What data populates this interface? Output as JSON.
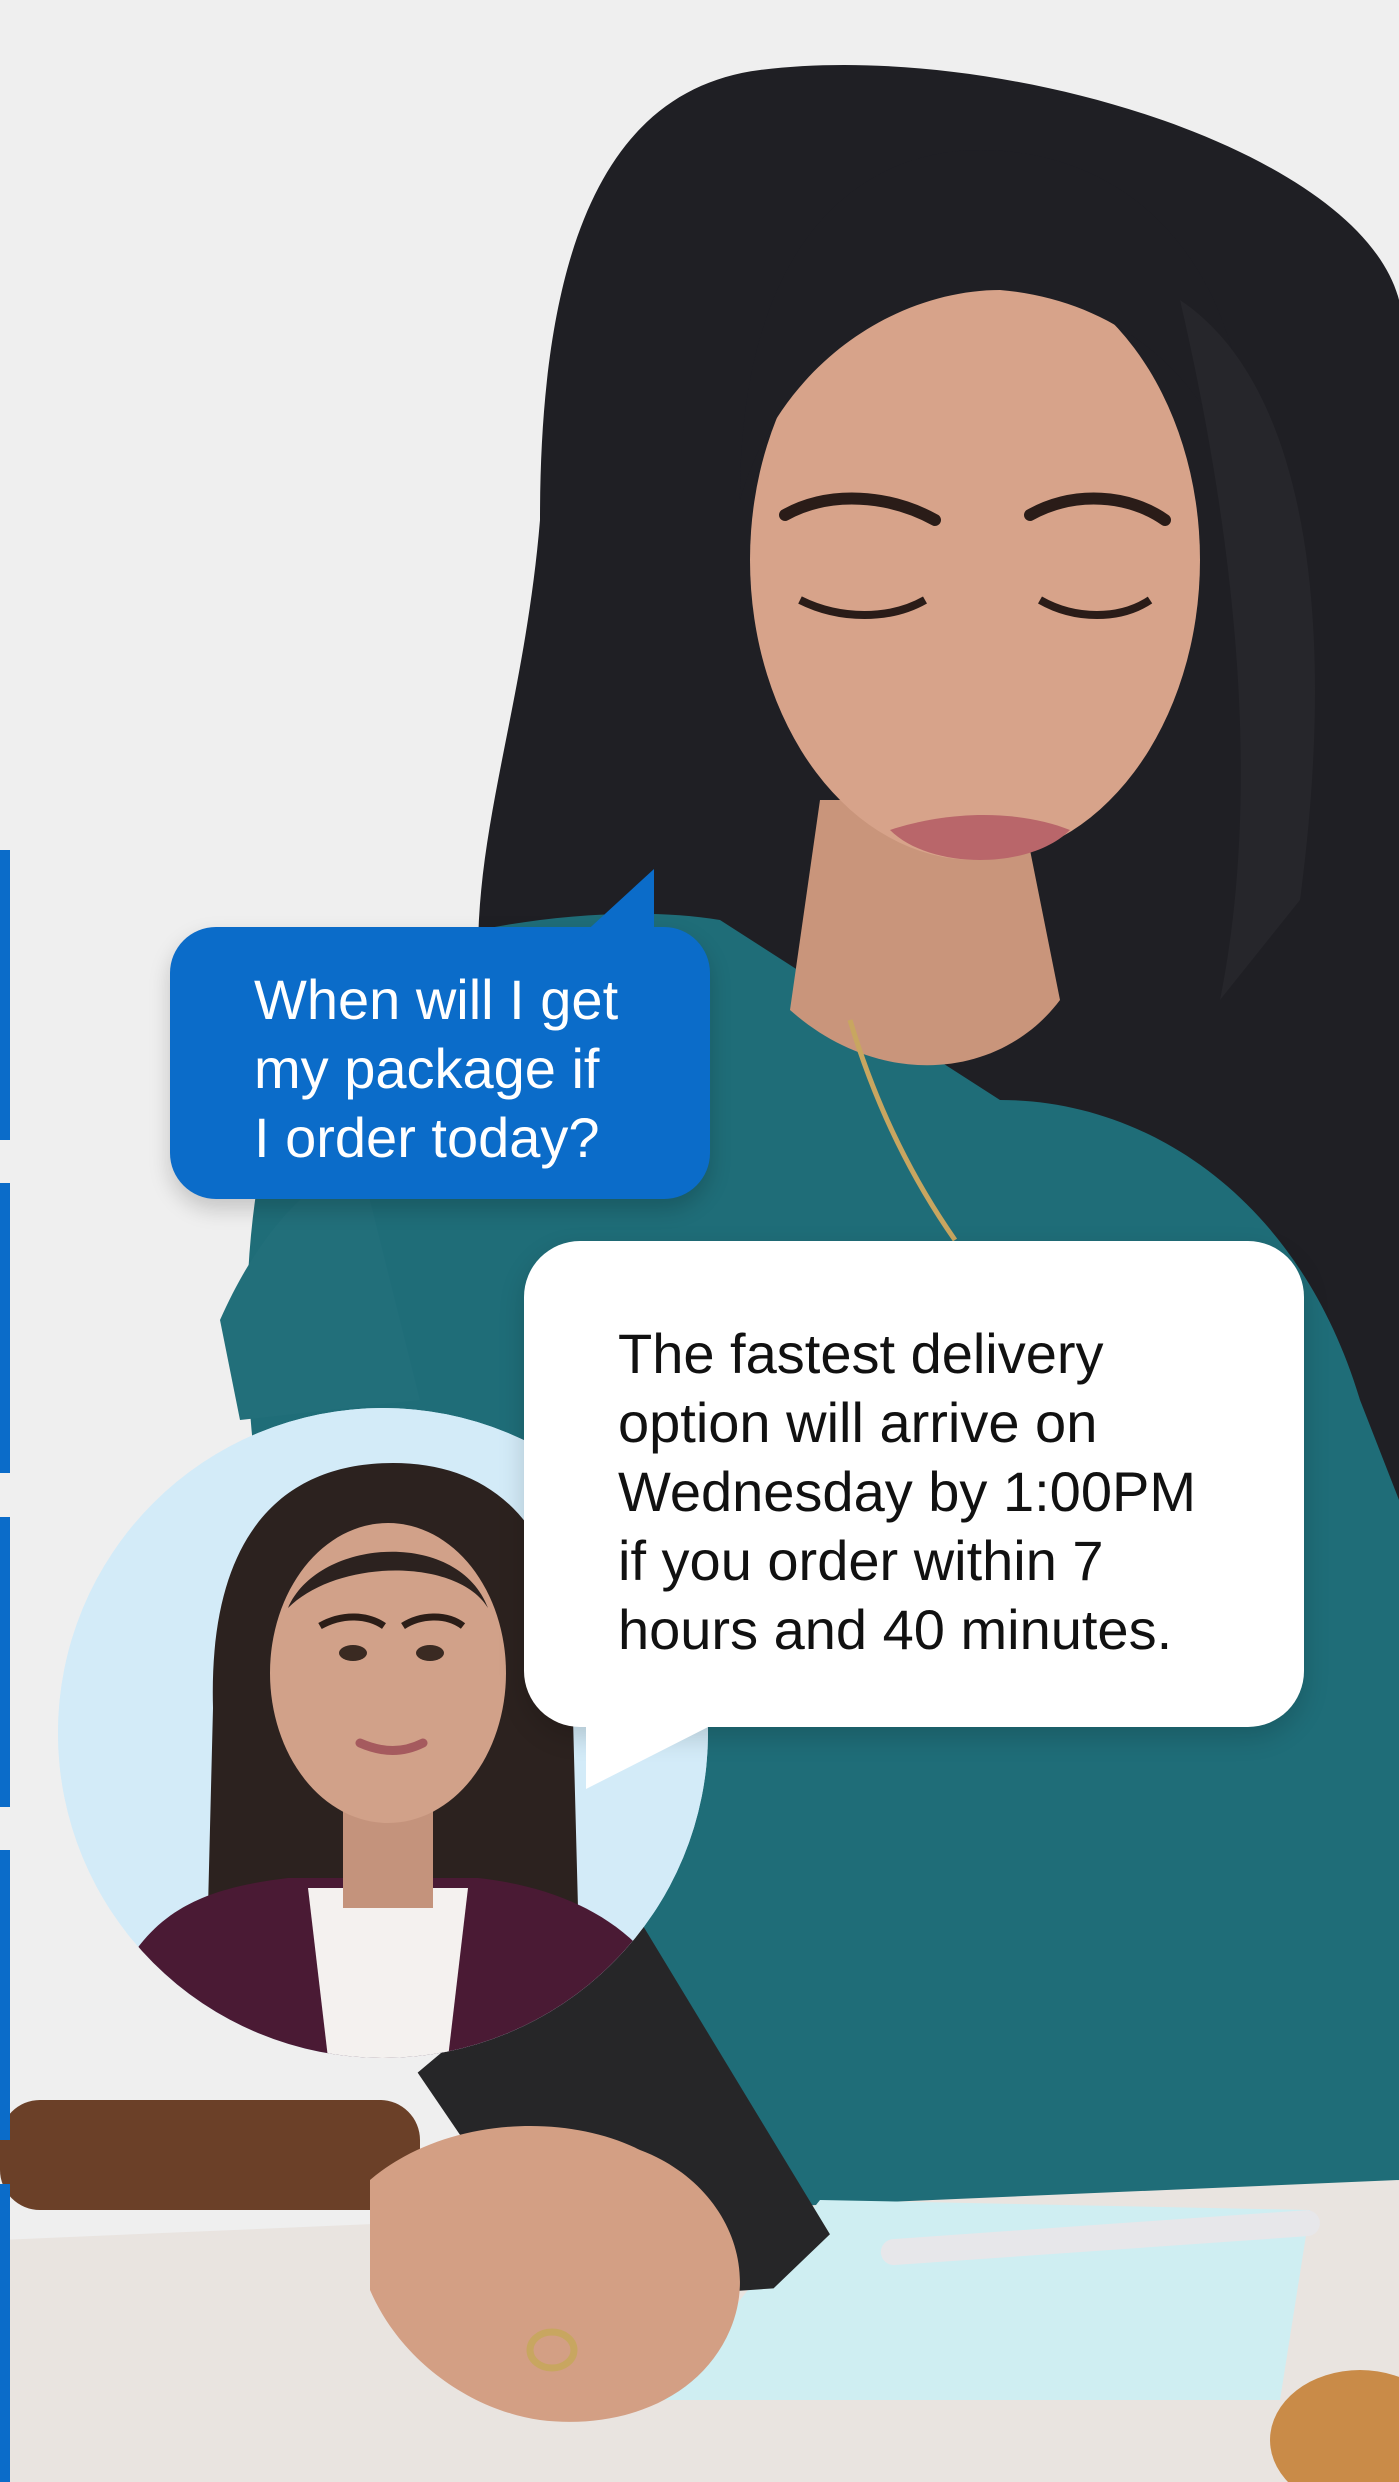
{
  "colors": {
    "background": "#efefef",
    "accent_blue": "#0b6cc9",
    "agent_bubble": "#ffffff",
    "shirt_teal": "#1f6d78",
    "avatar_background": "#d3ebf8"
  },
  "chat": {
    "user_message": {
      "lines": [
        "When will I get",
        "my package if",
        "I order today?"
      ]
    },
    "agent_reply": {
      "lines": [
        "The fastest delivery",
        "option will arrive on",
        "Wednesday by 1:00PM",
        "if you order within 7",
        "hours and 40 minutes."
      ]
    }
  },
  "icons": {
    "edge_accent": "vertical-bar-icon",
    "avatar": "virtual-agent-avatar"
  }
}
